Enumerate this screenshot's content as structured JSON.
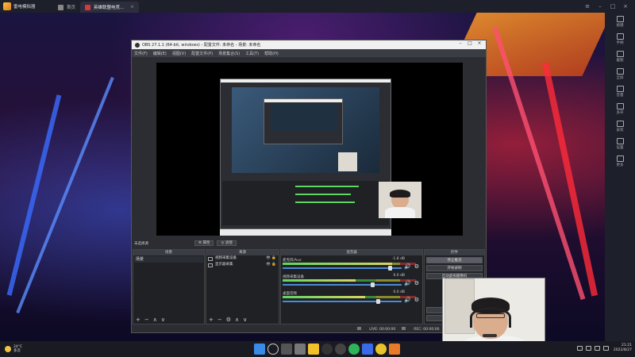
{
  "emulator": {
    "name": "雷电模拟器",
    "tabs": [
      {
        "label": "首页",
        "active": false
      },
      {
        "label": "英雄联盟电竞...",
        "active": true
      }
    ]
  },
  "obs": {
    "title": "OBS 27.1.1 (64-bit, windows) - 配置文件: 未命名 - 场景: 未命名",
    "menu": [
      "文件(F)",
      "编辑(E)",
      "视图(V)",
      "配置文件(P)",
      "场景集合(S)",
      "工具(T)",
      "帮助(H)"
    ],
    "no_source": "未选择源",
    "props_btn": "属性",
    "filters_btn": "滤镜",
    "docks": {
      "scenes": "场景",
      "sources": "来源",
      "mixer": "混音器",
      "controls": "控件"
    },
    "scenes": [
      "场景"
    ],
    "sources": [
      {
        "name": "视频采集设备"
      },
      {
        "name": "显示器采集"
      }
    ],
    "mixer": [
      {
        "name": "麦克风/Aux",
        "db": "-1.8 dB",
        "level": 0.82,
        "volume": 0.9
      },
      {
        "name": "视频采集设备",
        "db": "0.0 dB",
        "level": 0.55,
        "volume": 0.75
      },
      {
        "name": "桌面音频",
        "db": "0.0 dB",
        "level": 0.62,
        "volume": 0.8
      }
    ],
    "controls": [
      "停止推流",
      "开始录制",
      "启动虚拟摄像机",
      "工作室模式",
      "设置",
      "退出"
    ],
    "controls_visible": [
      "停止推流",
      "开始录制",
      "启动虚拟摄像机"
    ],
    "controls_bottom": [
      "设置",
      "退出"
    ],
    "status": {
      "live": "LIVE: 00:00:00",
      "rec": "REC: 00:00:00",
      "cpu": "CPU: 3.7%, 60.00 fps"
    }
  },
  "sidebar": [
    "按键",
    "手柄",
    "截图",
    "全屏",
    "音量",
    "多开",
    "安装",
    "设置",
    "更多"
  ],
  "taskbar": {
    "temp": "24°C",
    "weather": "多云",
    "time": "21:21",
    "date": "2022/8/27"
  },
  "colors": {
    "emu_bar": "#1d1f2b",
    "obs_bg": "#2b2d33",
    "accent_blue": "#4a8ad8"
  }
}
